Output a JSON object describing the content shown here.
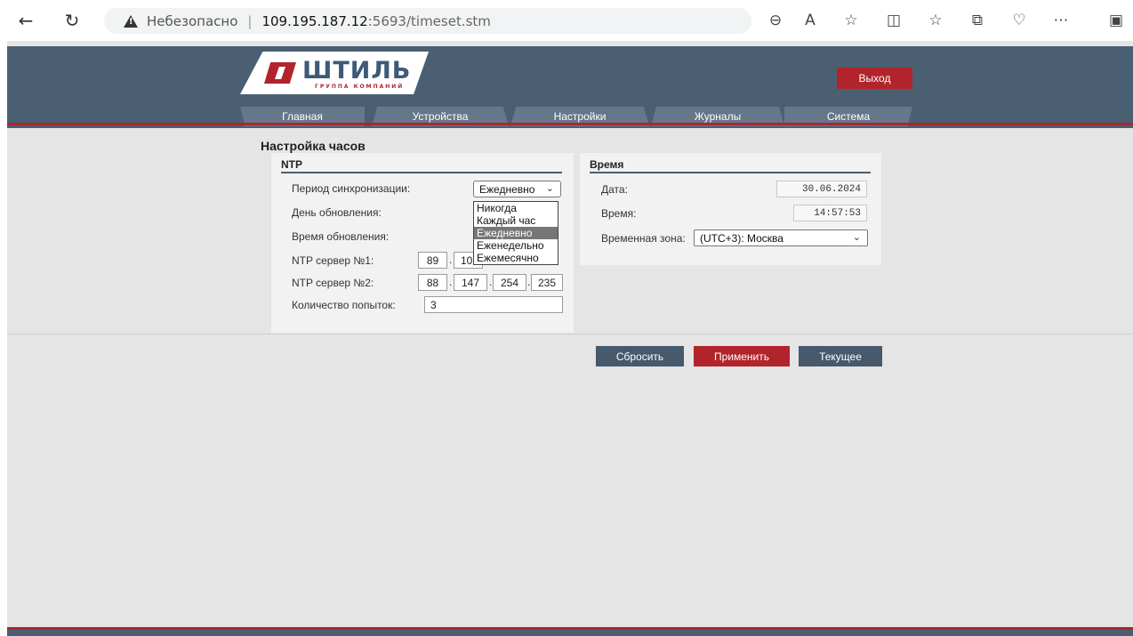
{
  "browser": {
    "back_icon": "back-arrow-icon",
    "refresh_icon": "refresh-icon",
    "security_label": "Небезопасно",
    "url_host": "109.195.187.12",
    "url_rest": ":5693/timeset.stm",
    "toolbar_icons": [
      "zoom-out-icon",
      "read-aloud-icon",
      "favorite-star-icon",
      "split-screen-icon",
      "favorites-list-icon",
      "collections-icon",
      "browser-essentials-icon",
      "more-icon",
      "sidebar-icon"
    ]
  },
  "header": {
    "logo_text": "ШТИЛЬ",
    "logo_sub": "ГРУППА КОМПАНИЙ",
    "exit_label": "Выход",
    "nav": [
      "Главная",
      "Устройства",
      "Настройки",
      "Журналы",
      "Система"
    ]
  },
  "page": {
    "title": "Настройка часов"
  },
  "ntp": {
    "title": "NTP",
    "sync_period_label": "Период синхронизации:",
    "sync_period_value": "Ежедневно",
    "update_day_label": "День обновления:",
    "update_time_label": "Время обновления:",
    "server1_label": "NTP сервер №1:",
    "server1": [
      "89",
      "10"
    ],
    "server2_label": "NTP сервер №2:",
    "server2": [
      "88",
      "147",
      "254",
      "235"
    ],
    "attempts_label": "Количество попыток:",
    "attempts_value": "3",
    "period_options": [
      "Никогда",
      "Каждый час",
      "Ежедневно",
      "Еженедельно",
      "Ежемесячно"
    ],
    "selected_option": "Ежедневно"
  },
  "time": {
    "title": "Время",
    "date_label": "Дата:",
    "date_value": "30.06.2024",
    "time_label": "Время:",
    "time_value": "14:57:53",
    "zone_label": "Временная зона:",
    "zone_value": "(UTC+3): Москва"
  },
  "actions": {
    "reset_label": "Сбросить",
    "apply_label": "Применить",
    "current_label": "Текущее"
  },
  "colors": {
    "header_bg": "#4b5f73",
    "accent_red": "#b1242b",
    "nav_tab": "#66778a",
    "page_bg": "#e5e5e5"
  }
}
